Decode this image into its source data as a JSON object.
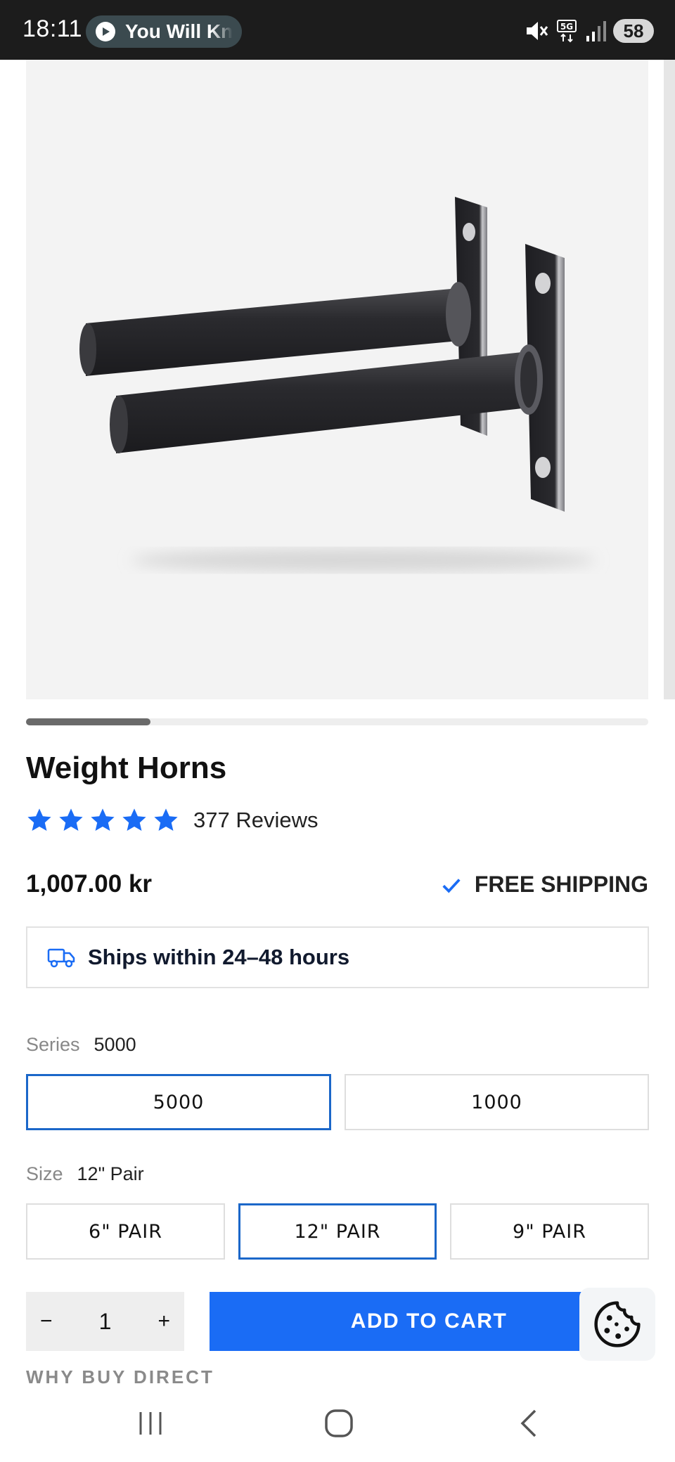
{
  "status_bar": {
    "time": "18:11",
    "media_text": "You Will Kn",
    "battery": "58",
    "icons": [
      "mute-icon",
      "5g-icon",
      "signal-icon",
      "battery-icon"
    ]
  },
  "product": {
    "title": "Weight Horns",
    "rating_stars": 5,
    "reviews": "377 Reviews",
    "price": "1,007.00 kr",
    "free_shipping": "FREE SHIPPING",
    "ships_within": "Ships within 24–48 hours",
    "carousel_progress": 0.2
  },
  "series": {
    "label": "Series",
    "selected": "5000",
    "options": [
      "5000",
      "1000"
    ]
  },
  "size": {
    "label": "Size",
    "selected": "12\" Pair",
    "options": [
      "6\" PAIR",
      "12\" PAIR",
      "9\" PAIR"
    ]
  },
  "cart": {
    "minus": "−",
    "quantity": "1",
    "plus": "+",
    "add_to_cart": "ADD TO CART"
  },
  "section": {
    "why_buy_direct": "WHY BUY DIRECT"
  },
  "colors": {
    "accent": "#1a6cf5",
    "star": "#1a6cf5",
    "selected_border": "#1b67c9"
  }
}
